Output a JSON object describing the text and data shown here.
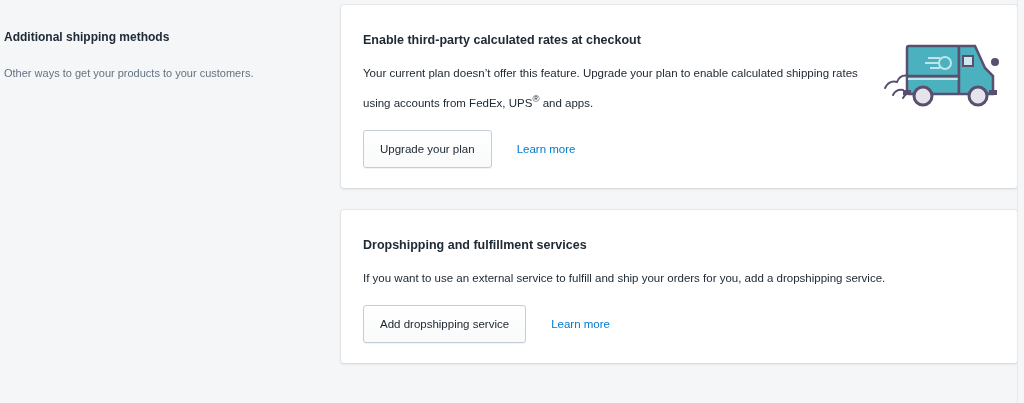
{
  "section": {
    "title": "Additional shipping methods",
    "description": "Other ways to get your products to your customers."
  },
  "cards": [
    {
      "title": "Enable third-party calculated rates at checkout",
      "body": "Your current plan doesn’t offer this feature. Upgrade your plan to enable calculated shipping rates using accounts from FedEx, UPS$^{®}$ and apps.",
      "button": "Upgrade your plan",
      "link": "Learn more",
      "kind": "illustrated"
    },
    {
      "title": "Dropshipping and fulfillment services",
      "body": "If you want to use an external service to fulfill and ship your orders for you, add a dropshipping service.",
      "button": "Add dropshipping service",
      "link": "Learn more",
      "kind": "plain"
    }
  ]
}
